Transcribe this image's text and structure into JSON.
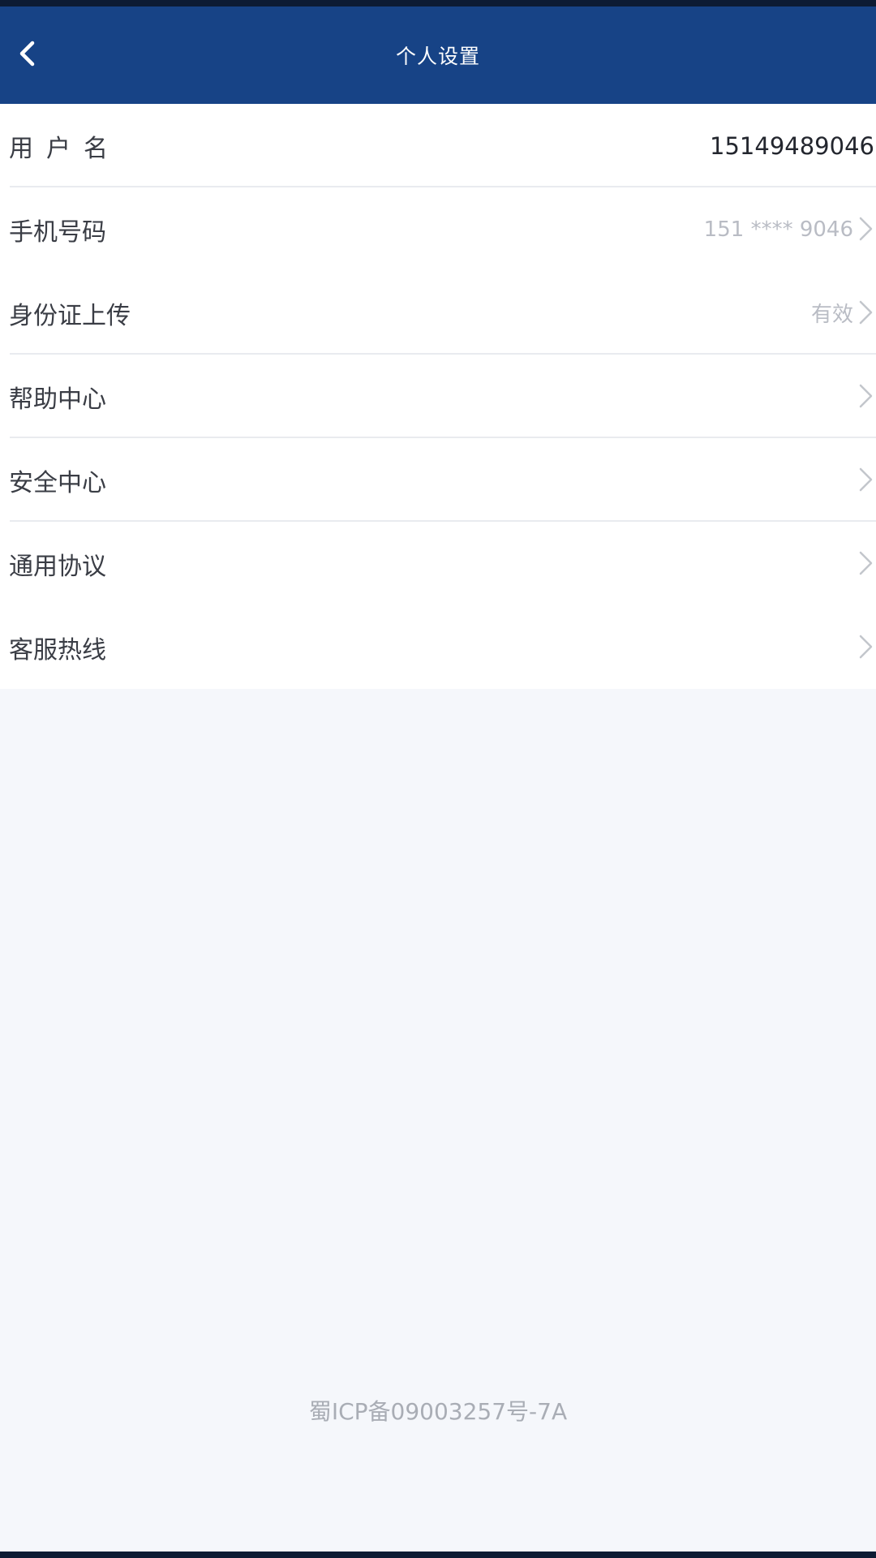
{
  "header": {
    "title": "个人设置",
    "back_icon": "chevron-left-icon",
    "background_color": "#174386"
  },
  "settings": {
    "username": {
      "label": "用户名",
      "value": "15149489046"
    },
    "phone": {
      "label": "手机号码",
      "value": "151 **** 9046"
    },
    "id_upload": {
      "label": "身份证上传",
      "value": "有效"
    },
    "help_center": {
      "label": "帮助中心"
    },
    "security_center": {
      "label": "安全中心"
    },
    "general_agreement": {
      "label": "通用协议"
    },
    "customer_hotline": {
      "label": "客服热线"
    }
  },
  "footer": {
    "icp": "蜀ICP备09003257号-7A"
  },
  "icons": {
    "row_arrow": "chevron-right-icon"
  }
}
